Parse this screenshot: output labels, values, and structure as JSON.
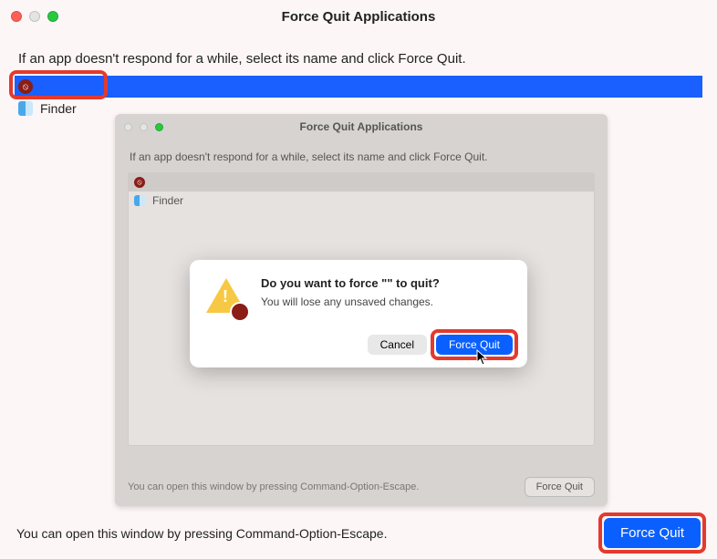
{
  "outer": {
    "title": "Force Quit Applications",
    "instruction": "If an app doesn't respond for a while, select its name and click Force Quit.",
    "hint": "You can open this window by pressing Command-Option-Escape.",
    "force_quit_label": "Force Quit",
    "list": {
      "selected_label": "",
      "finder_label": "Finder"
    }
  },
  "inner": {
    "title": "Force Quit Applications",
    "instruction": "If an app doesn't respond for a while, select its name and click Force Quit.",
    "hint": "You can open this window by pressing Command-Option-Escape.",
    "force_quit_label": "Force Quit",
    "list": {
      "selected_label": "",
      "finder_label": "Finder"
    }
  },
  "modal": {
    "question": "Do you want to force \"\" to quit?",
    "subtext": "You will lose any unsaved changes.",
    "cancel_label": "Cancel",
    "confirm_label": "Force Quit"
  }
}
